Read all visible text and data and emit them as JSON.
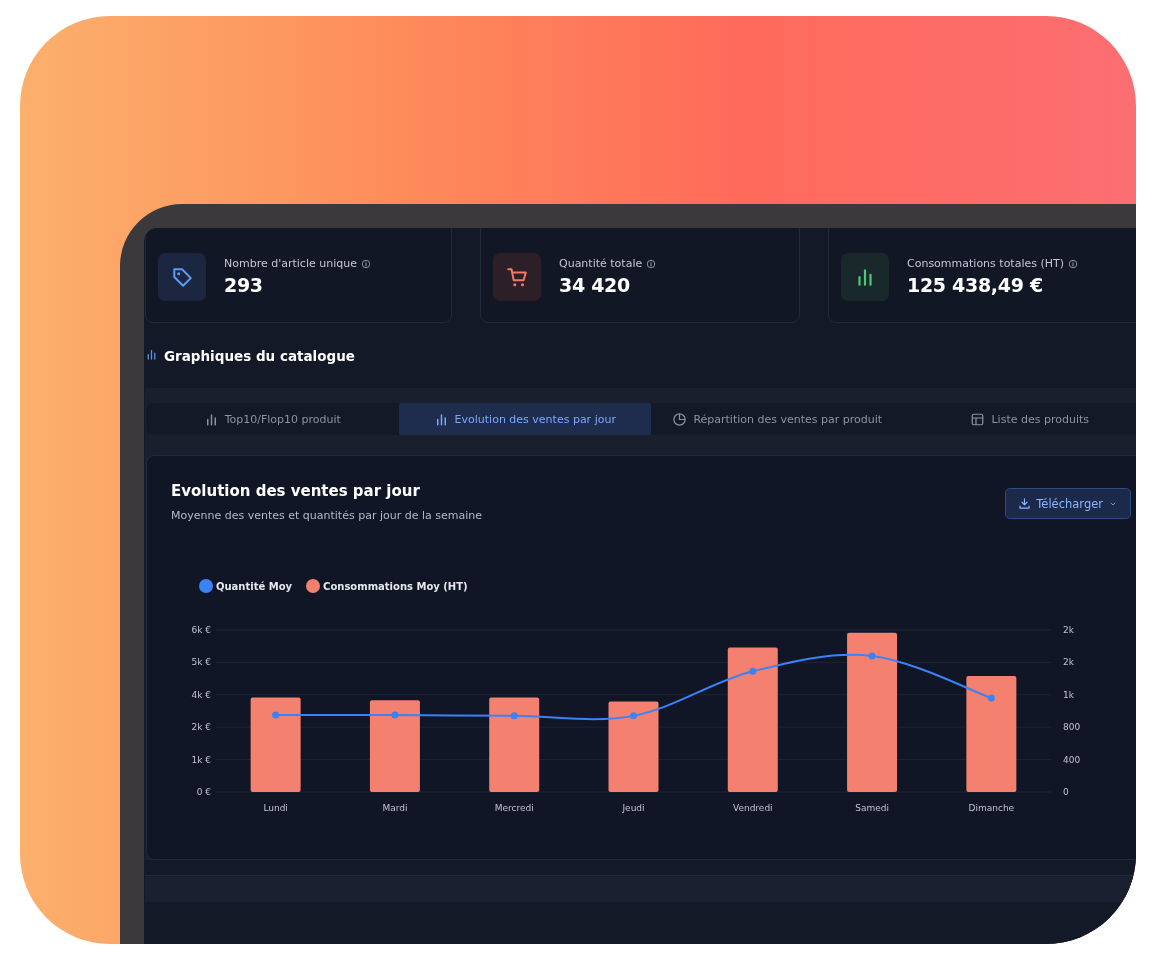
{
  "stats": [
    {
      "label": "Nombre d'article unique",
      "value": "293",
      "kind": "tag"
    },
    {
      "label": "Quantité totale",
      "value": "34 420",
      "kind": "cart"
    },
    {
      "label": "Consommations totales (HT)",
      "value": "125 438,49 €",
      "kind": "bars"
    }
  ],
  "section": {
    "title": "Graphiques du catalogue"
  },
  "tabs": [
    {
      "label": "Top10/Flop10 produit",
      "kind": "bars",
      "selected": false
    },
    {
      "label": "Evolution des ventes par jour",
      "kind": "bars",
      "selected": true
    },
    {
      "label": "Répartition des ventes par produit",
      "kind": "pie",
      "selected": false
    },
    {
      "label": "Liste des produits",
      "kind": "table",
      "selected": false
    }
  ],
  "chart_card": {
    "title": "Evolution des ventes par jour",
    "subtitle": "Moyenne des ventes et quantités par jour de la semaine",
    "download_button": "Télécharger",
    "chart_data": {
      "type": "bar",
      "categories": [
        "Lundi",
        "Mardi",
        "Mercredi",
        "Jeudi",
        "Vendredi",
        "Samedi",
        "Dimanche"
      ],
      "series": [
        {
          "name": "Quantité Moy",
          "color": "#3b82f6",
          "type": "line",
          "axis": "y2",
          "marker": true,
          "values": [
            950,
            950,
            940,
            940,
            1490,
            1680,
            1160
          ]
        },
        {
          "name": "Consommations Moy (HT)",
          "color": "#f4806f",
          "values": [
            3500,
            3400,
            3500,
            3350,
            5350,
            5900,
            4300
          ]
        }
      ],
      "grid": true,
      "ylim": [
        0,
        6000
      ],
      "yticks": [
        {
          "value": 0,
          "label": "0 €"
        },
        {
          "value": 1200,
          "label": "1k €"
        },
        {
          "value": 2400,
          "label": "2k €"
        },
        {
          "value": 3600,
          "label": "4k €"
        },
        {
          "value": 4800,
          "label": "5k €"
        },
        {
          "value": 6000,
          "label": "6k €"
        }
      ],
      "y2lim": [
        0,
        2000
      ],
      "y2ticks": [
        {
          "value": 0,
          "label": "0"
        },
        {
          "value": 400,
          "label": "400"
        },
        {
          "value": 800,
          "label": "800"
        },
        {
          "value": 1200,
          "label": "1k"
        },
        {
          "value": 1600,
          "label": "2k"
        },
        {
          "value": 2000,
          "label": "2k"
        }
      ]
    }
  }
}
